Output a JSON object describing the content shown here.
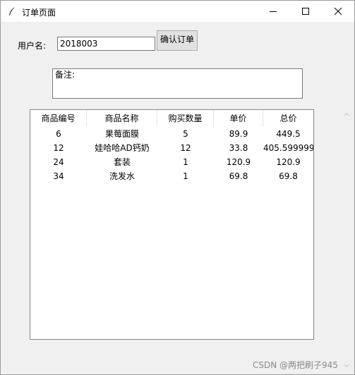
{
  "window": {
    "title": "订单页面",
    "icon": "feather-icon"
  },
  "form": {
    "user_label": "用户名:",
    "user_value": "2018003",
    "confirm_label": "确认订单",
    "remark_text": "备注:"
  },
  "table": {
    "headers": [
      "商品编号",
      "商品名称",
      "购买数量",
      "单价",
      "总价"
    ],
    "rows": [
      [
        "6",
        "果莓面膜",
        "5",
        "89.9",
        "449.5"
      ],
      [
        "12",
        "娃哈哈AD钙奶",
        "12",
        "33.8",
        "405.599999"
      ],
      [
        "24",
        "套装",
        "1",
        "120.9",
        "120.9"
      ],
      [
        "34",
        "洗发水",
        "1",
        "69.8",
        "69.8"
      ]
    ]
  },
  "watermark": "CSDN @两把刷子945"
}
